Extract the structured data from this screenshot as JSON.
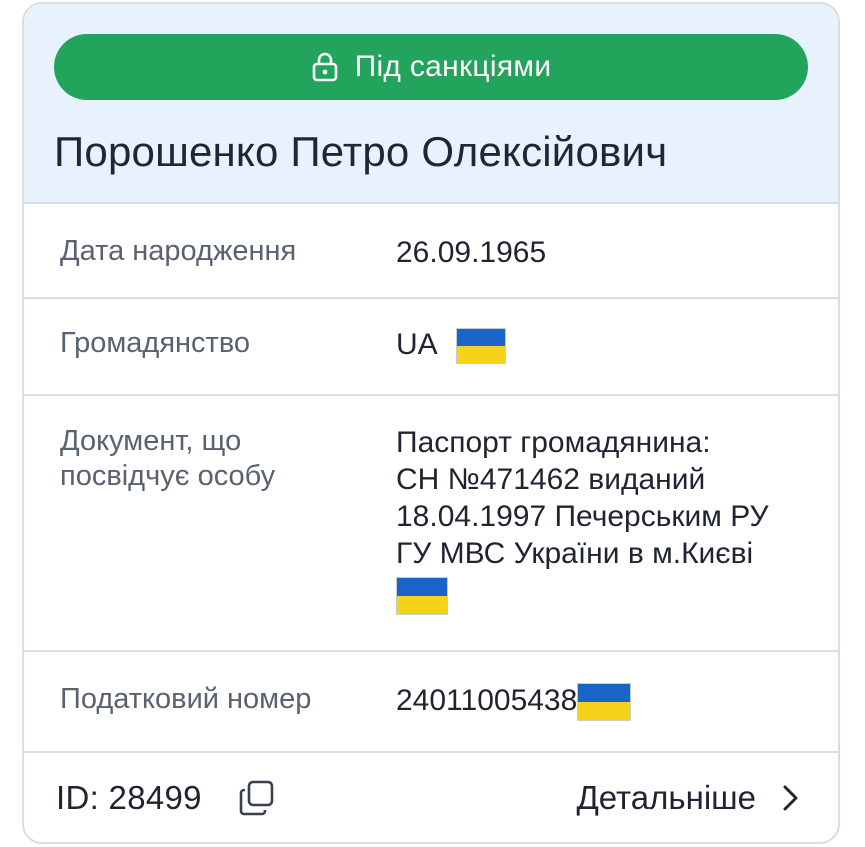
{
  "status": {
    "label": "Під санкціями",
    "icon": "lock-icon",
    "color": "#22a45d"
  },
  "person": {
    "name": "Порошенко Петро Олексійович"
  },
  "fields": {
    "birth_date": {
      "label": "Дата народження",
      "value": "26.09.1965"
    },
    "citizenship": {
      "label": "Громадянство",
      "value": "UA",
      "flag": "flag-ukraine"
    },
    "identity_document": {
      "label_line1": "Документ, що",
      "label_line2": "посвідчує особу",
      "value_line1": "Паспорт громадянина:",
      "value_line2": "СН №471462 виданий",
      "value_line3": "18.04.1997 Печерським РУ",
      "value_line4": "ГУ МВС України в м.Києві",
      "flag": "flag-ukraine"
    },
    "tax_number": {
      "label": "Податковий номер",
      "value": "24011005438",
      "flag": "flag-ukraine"
    }
  },
  "footer": {
    "id_text": "ID: 28499",
    "copy_icon": "copy-icon",
    "details_label": "Детальніше",
    "details_icon": "chevron-right-icon"
  },
  "colors": {
    "header_bg": "#e8f2fd",
    "border": "#d9dde3",
    "flag_blue": "#1a64c8",
    "flag_yellow": "#f7d21b"
  }
}
